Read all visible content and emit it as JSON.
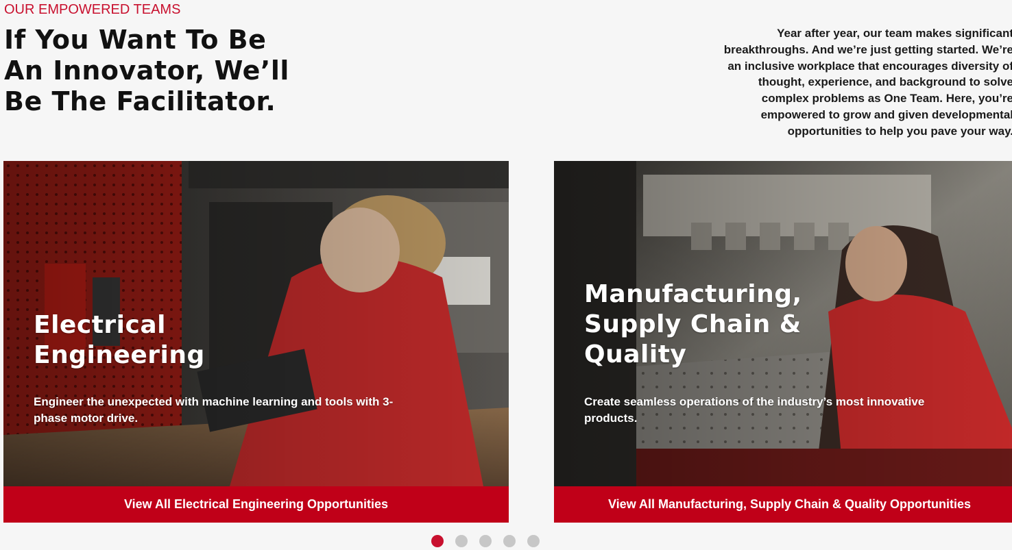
{
  "section": {
    "eyebrow": "OUR EMPOWERED TEAMS",
    "headline": "If You Want To Be\nAn Innovator, We’ll\nBe The Facilitator.",
    "intro": "Year after year, our team makes significant\nbreakthroughs. And we’re just getting started. We’re\nan inclusive workplace that encourages diversity of\nthought, experience, and background to solve\ncomplex problems as One Team. Here, you’re\nempowered to grow and given developmental\nopportunities to help you pave your way."
  },
  "cards": [
    {
      "title": "Electrical\nEngineering",
      "description": "Engineer the unexpected with machine learning and tools with 3-\nphase motor drive.",
      "cta": "View All Electrical Engineering Opportunities"
    },
    {
      "title": "Manufacturing,\nSupply Chain &\nQuality",
      "description": "Create seamless operations of the industry’s most innovative\nproducts.",
      "cta": "View All Manufacturing, Supply Chain & Quality Opportunities"
    }
  ],
  "carousel": {
    "slide_count": 5,
    "active_index": 0
  },
  "colors": {
    "accent": "#c8102e",
    "cta_background": "#c00018",
    "dot_inactive": "#c7c7c7",
    "page_background": "#f6f6f6"
  }
}
